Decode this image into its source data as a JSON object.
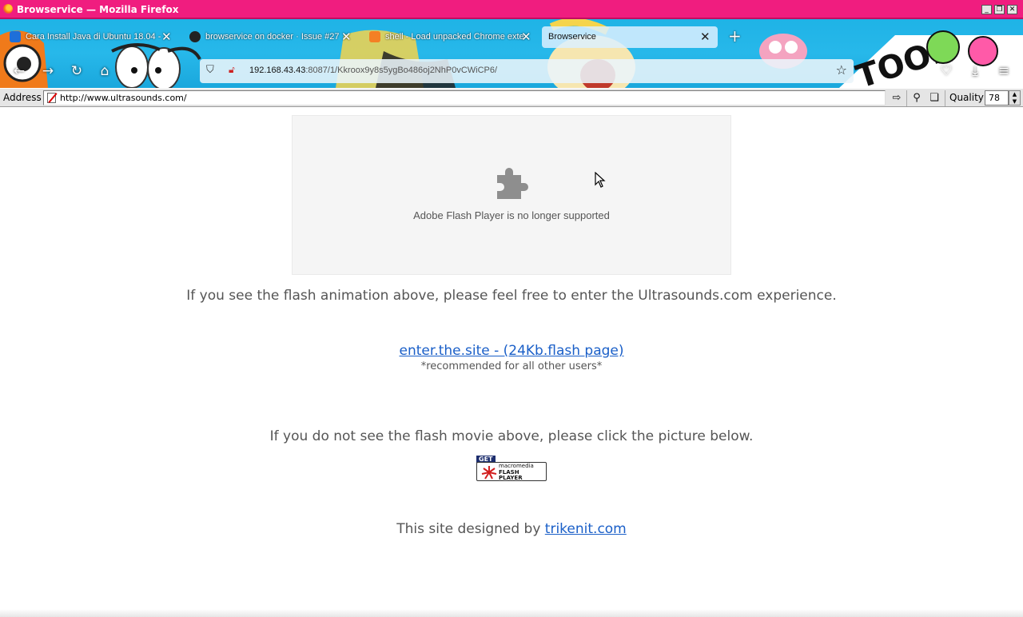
{
  "window": {
    "title": "Browservice — Mozilla Firefox",
    "buttons": [
      "_",
      "❐",
      "✕"
    ]
  },
  "tabs": [
    {
      "label": "Cara Install Java di Ubuntu 18.04 -",
      "icon": "wave-favicon-icon"
    },
    {
      "label": "browservice on docker · Issue #27",
      "icon": "github-icon"
    },
    {
      "label": "shell - Load unpacked Chrome exte",
      "icon": "stackoverflow-icon"
    },
    {
      "label": "Browservice",
      "icon": "",
      "active": true
    }
  ],
  "nav": {
    "url_host": "192.168.43.43",
    "url_rest": ":8087/1/Kkroox9y8s5ygBo486oj2NhP0vCWiCP6/"
  },
  "address_toolbar": {
    "label": "Address",
    "url": "http://www.ultrasounds.com/",
    "quality_label": "Quality",
    "quality_value": "78"
  },
  "page": {
    "flash_message": "Adobe Flash Player is no longer supported",
    "intro": "If you see the flash animation above, please feel free to enter the Ultrasounds.com experience.",
    "enter_link": "enter.the.site - (24Kb.flash page)",
    "recommended": "*recommended for all other users*",
    "no_flash": "If you do not see the flash movie above, please click the picture below.",
    "badge": {
      "get": "GET",
      "line1": "macromedia",
      "line2": "FLASH",
      "line3": "PLAYER"
    },
    "designed_by": "This site designed by",
    "designer_link": "trikenit.com"
  },
  "colors": {
    "titlebar": "#f01d7f",
    "link": "#1a5fc8",
    "chrome_theme": "#1fb3e6"
  }
}
